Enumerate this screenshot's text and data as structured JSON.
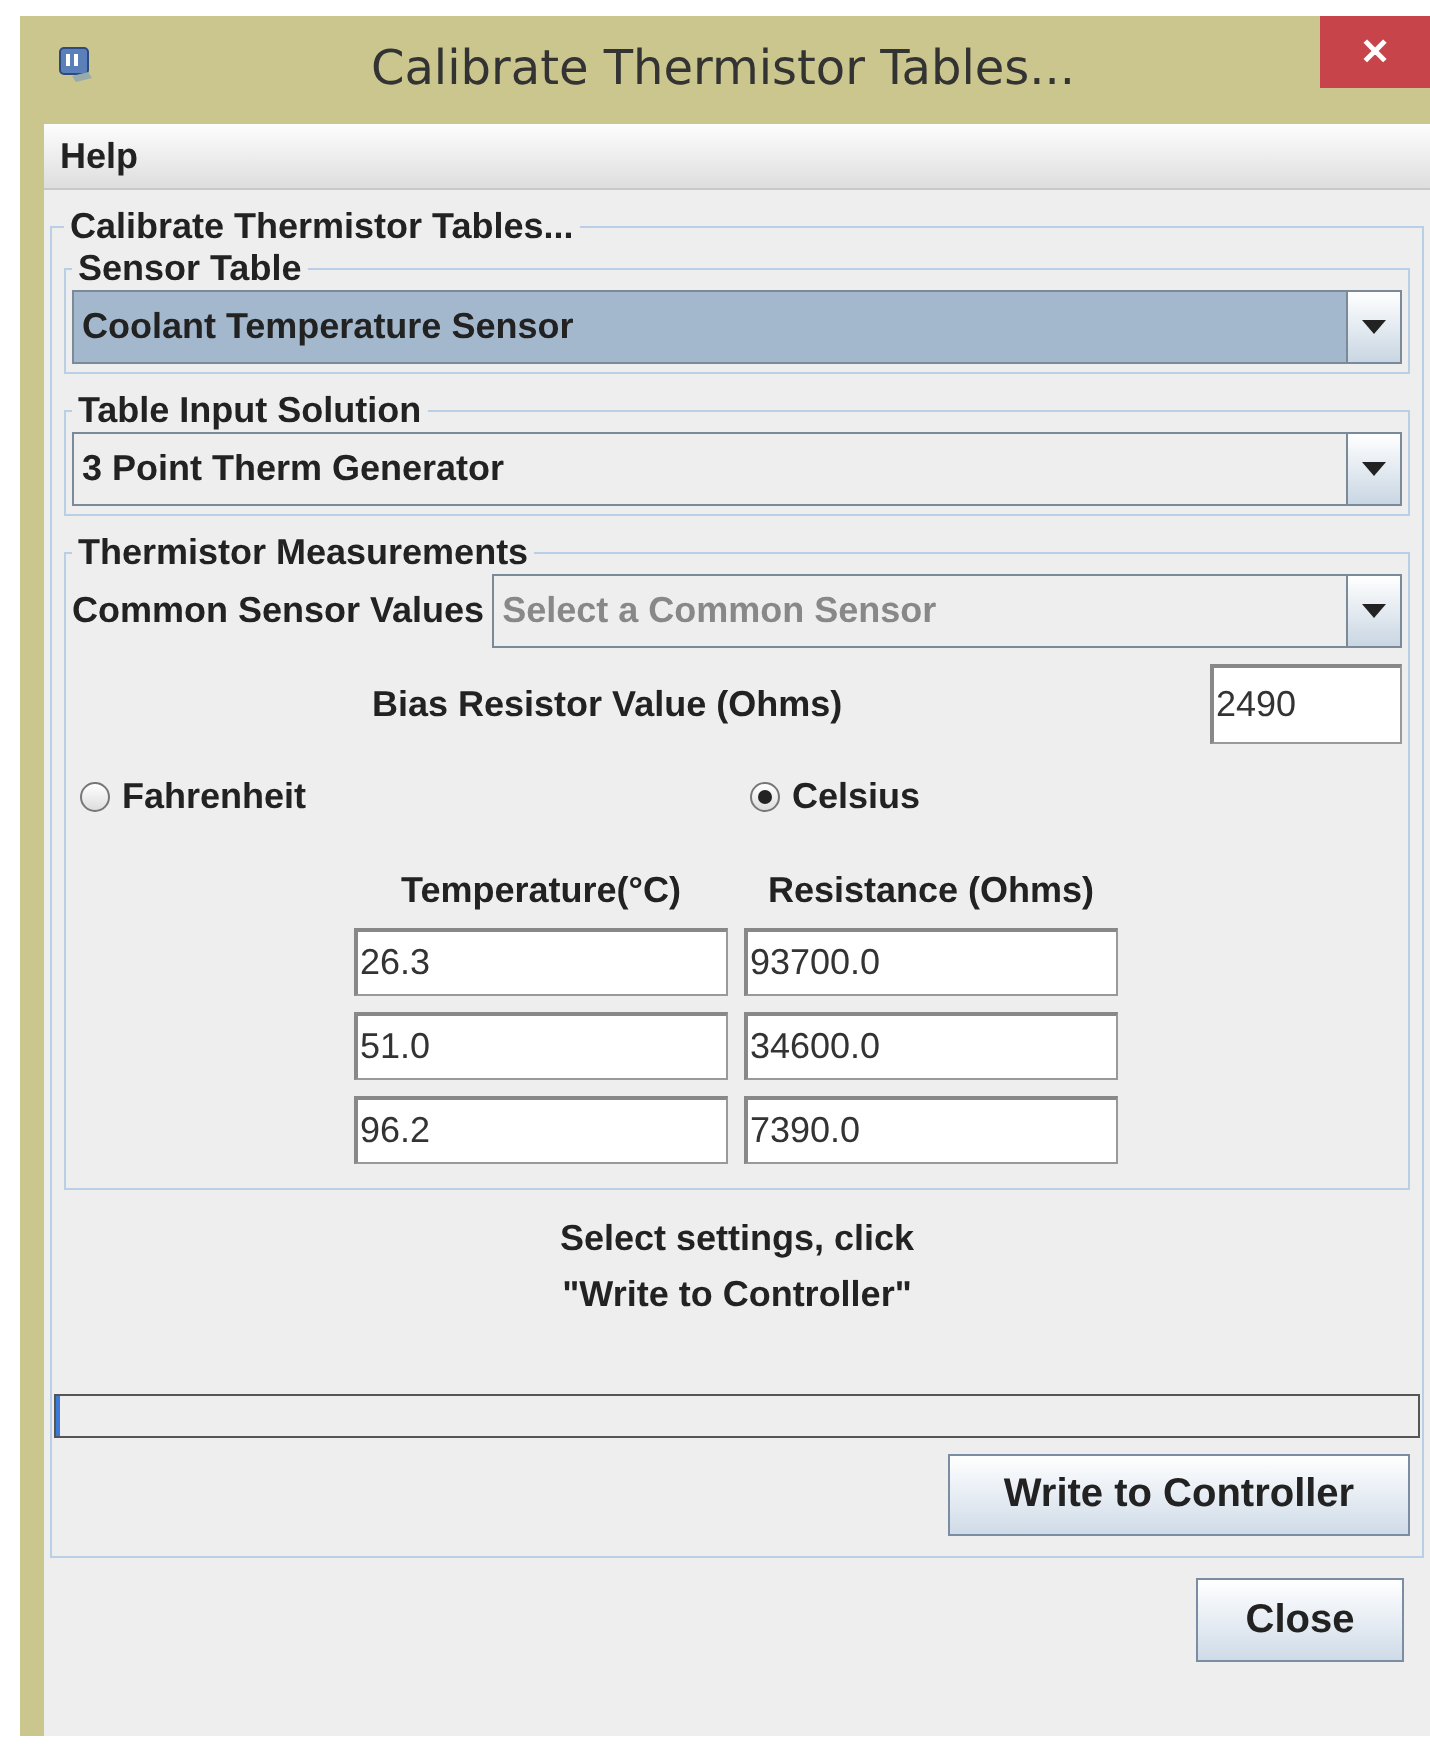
{
  "window": {
    "title": "Calibrate Thermistor Tables...",
    "close": "✕"
  },
  "menu": [
    "Help"
  ],
  "panel": {
    "title": "Calibrate Thermistor Tables..."
  },
  "sensor_table": {
    "title": "Sensor Table",
    "value": "Coolant Temperature Sensor",
    "selected": true
  },
  "input_solution": {
    "title": "Table Input Solution",
    "value": "3 Point Therm Generator",
    "selected": false
  },
  "measurements": {
    "title": "Thermistor Measurements",
    "common_label": "Common Sensor Values",
    "common_placeholder": "Select a Common Sensor",
    "bias_label": "Bias Resistor Value (Ohms)",
    "bias_value": "2490",
    "units": [
      {
        "label": "Fahrenheit",
        "selected": false
      },
      {
        "label": "Celsius",
        "selected": true
      }
    ],
    "columns": [
      "Temperature(°C)",
      "Resistance (Ohms)"
    ],
    "rows": [
      [
        "26.3",
        "93700.0"
      ],
      [
        "51.0",
        "34600.0"
      ],
      [
        "96.2",
        "7390.0"
      ]
    ]
  },
  "message": [
    "Select settings, click",
    "\"Write to Controller\""
  ],
  "progress": {
    "level": 0
  },
  "buttons": {
    "write": "Write to Controller",
    "close": "Close"
  }
}
